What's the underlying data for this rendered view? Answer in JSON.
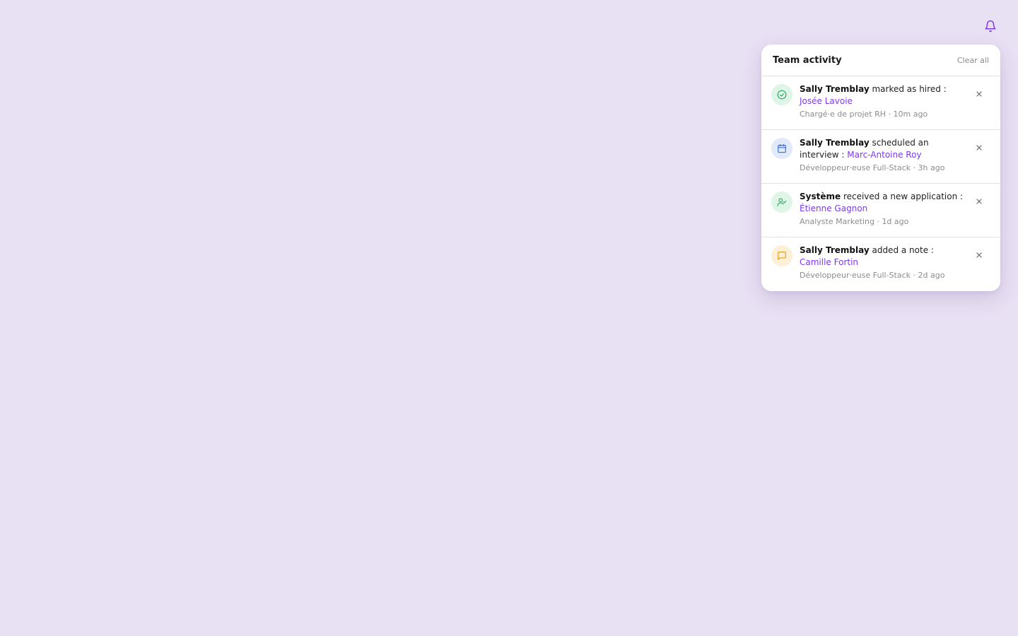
{
  "header": {
    "title": "Team activity",
    "clear_label": "Clear all",
    "bell_icon": "bell-icon"
  },
  "colors": {
    "accent": "#7c3aed",
    "background": "#e8e0f3",
    "green": "#2fa862",
    "blue": "#3b6fd8",
    "amber": "#e0a020"
  },
  "activities": [
    {
      "icon": "check-circle-icon",
      "actor": "Sally Tremblay",
      "action": " marked as hired : ",
      "candidate": "Josée Lavoie",
      "job": "Chargé·e de projet RH",
      "separator": " · ",
      "time": "10m ago"
    },
    {
      "icon": "calendar-icon",
      "actor": "Sally Tremblay",
      "action": " scheduled an interview : ",
      "candidate": "Marc-Antoine Roy",
      "job": "Développeur·euse Full-Stack",
      "separator": " · ",
      "time": "3h ago"
    },
    {
      "icon": "user-check-icon",
      "actor": "Système",
      "action": " received a new application : ",
      "candidate": "Étienne Gagnon",
      "job": "Analyste Marketing",
      "separator": " · ",
      "time": "1d ago"
    },
    {
      "icon": "message-square-icon",
      "actor": "Sally Tremblay",
      "action": " added a note : ",
      "candidate": "Camille Fortin",
      "job": "Développeur·euse Full-Stack",
      "separator": " · ",
      "time": "2d ago"
    }
  ]
}
